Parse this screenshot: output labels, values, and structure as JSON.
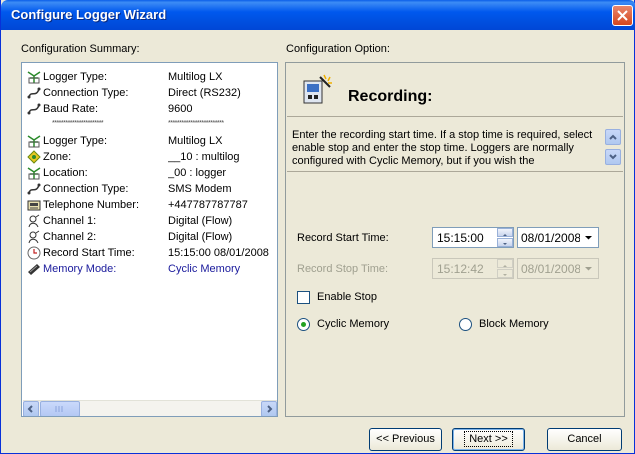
{
  "window": {
    "title": "Configure Logger Wizard"
  },
  "summary": {
    "heading": "Configuration Summary:",
    "rows": [
      {
        "icon": "logger-icon",
        "label": "Logger Type:",
        "value": "Multilog LX"
      },
      {
        "icon": "connection-icon",
        "label": "Connection Type:",
        "value": "Direct (RS232)"
      },
      {
        "icon": "connection-icon",
        "label": "Baud Rate:",
        "value": "9600"
      },
      {
        "separator": true,
        "label": "***********************",
        "value": "*************************"
      },
      {
        "icon": "logger-icon",
        "label": "Logger Type:",
        "value": "Multilog LX"
      },
      {
        "icon": "zone-icon",
        "label": "Zone:",
        "value": "__10 : multilog"
      },
      {
        "icon": "logger-icon",
        "label": "Location:",
        "value": "_00 : logger"
      },
      {
        "icon": "connection-icon",
        "label": "Connection Type:",
        "value": "SMS Modem"
      },
      {
        "icon": "telephone-icon",
        "label": "Telephone Number:",
        "value": "+447787787787"
      },
      {
        "icon": "channel-icon",
        "label": "Channel 1:",
        "value": "Digital (Flow)"
      },
      {
        "icon": "channel-icon",
        "label": "Channel 2:",
        "value": "Digital (Flow)"
      },
      {
        "icon": "clock-icon",
        "label": "Record Start Time:",
        "value": "15:15:00 08/01/2008"
      },
      {
        "icon": "memory-icon",
        "label": "Memory Mode:",
        "value": "Cyclic Memory",
        "highlight": true
      }
    ]
  },
  "option": {
    "heading": "Configuration Option:",
    "title": "Recording:",
    "description": "Enter the recording start time. If a stop time is required, select enable stop and enter the stop time. Loggers are normally configured with Cyclic Memory, but if you wish the",
    "start_label": "Record Start Time:",
    "start_time": "15:15:00",
    "start_date": "08/01/2008",
    "stop_label": "Record Stop Time:",
    "stop_time": "15:12:42",
    "stop_date": "08/01/2008",
    "enable_stop_label": "Enable Stop",
    "enable_stop_checked": false,
    "cyclic_label": "Cyclic Memory",
    "block_label": "Block Memory",
    "selected_memory": "cyclic"
  },
  "buttons": {
    "previous": "<< Previous",
    "next": "Next >>",
    "cancel": "Cancel"
  },
  "colors": {
    "title_bar": "#0054e3",
    "highlight_text": "#1a1a9c",
    "close_button": "#d4461e"
  }
}
